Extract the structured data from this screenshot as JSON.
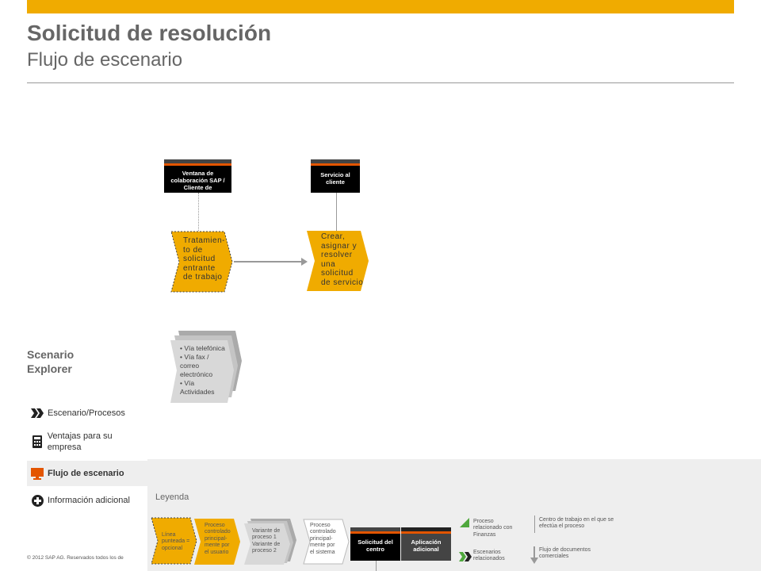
{
  "header": {
    "title": "Solicitud de resolución",
    "subtitle": "Flujo de escenario"
  },
  "lanes": [
    {
      "label": "Ventana de colaboración SAP / Cliente de"
    },
    {
      "label": "Servicio al cliente"
    }
  ],
  "steps": [
    {
      "label": "Tratamien-\nto de\nsolicitud\nentrante\nde trabajo"
    },
    {
      "label": "Crear,\nasignar y\nresolver\nuna\nsolicitud\nde servicio"
    }
  ],
  "channels": [
    "Vía telefónica",
    "Vía fax / correo electrónico",
    "Vía Actividades"
  ],
  "explorer": {
    "title": "Scenario\nExplorer",
    "items": [
      {
        "label": "Escenario/Procesos",
        "icon": "chevrons-icon"
      },
      {
        "label": "Ventajas para su empresa",
        "icon": "calculator-icon"
      },
      {
        "label": "Flujo de escenario",
        "icon": "monitor-icon",
        "active": true
      },
      {
        "label": "Información adicional",
        "icon": "plus-circle-icon"
      }
    ]
  },
  "copyright": "© 2012 SAP AG. Reservados todos los de",
  "legend": {
    "title": "Leyenda",
    "dotted": "Línea punteada = opcional",
    "user_process": "Proceso controlado principal-mente por el usuario",
    "variants": [
      "Variante de proceso 1",
      "Variante de proceso 2"
    ],
    "system_process": "Proceso controlado principal-mente por el sistema",
    "center_lane": "Solicitud del centro",
    "app_lane": "Aplicación adicional",
    "finance": "Proceso relacionado con Finanzas",
    "related": "Escenarios relacionados",
    "work_center": "Centro de trabajo en el que se efectúa el proceso",
    "doc_flow": "Flujo de documentos comerciales"
  },
  "colors": {
    "accent": "#f0ab00",
    "lane_stripe": "#e35500",
    "legend_bg": "#eeeeee",
    "green": "#4fa83d"
  }
}
